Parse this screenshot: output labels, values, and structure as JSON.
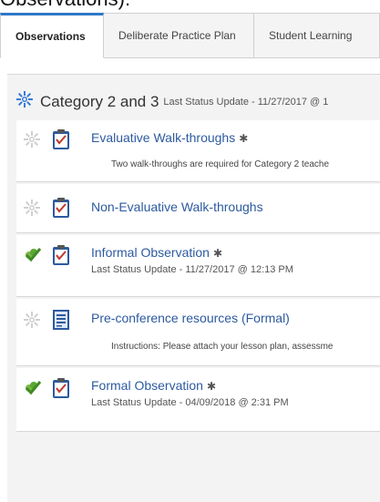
{
  "page_heading_fragment": "Observations):",
  "tabs": [
    {
      "label": "Observations",
      "active": true
    },
    {
      "label": "Deliberate Practice Plan",
      "active": false
    },
    {
      "label": "Student Learning",
      "active": false
    }
  ],
  "category": {
    "title": "Category 2 and 3",
    "status": "Last Status Update - 11/27/2017 @ 1",
    "icon": "gear-icon"
  },
  "items": [
    {
      "title": "Evaluative Walk-throughs",
      "required": "✱",
      "status_icon": "pending-gear-icon",
      "doc_icon": "clipboard-icon",
      "description": "Two walk-throughs are required for Category 2 teache"
    },
    {
      "title": "Non-Evaluative Walk-throughs",
      "status_icon": "pending-gear-icon",
      "doc_icon": "clipboard-icon"
    },
    {
      "title": "Informal Observation",
      "required": "✱",
      "status_icon": "complete-check-icon",
      "doc_icon": "clipboard-icon",
      "sub": "Last Status Update - 11/27/2017 @ 12:13 PM"
    },
    {
      "title": "Pre-conference resources (Formal)",
      "status_icon": "pending-gear-icon",
      "doc_icon": "document-icon",
      "description": "Instructions: Please attach your lesson plan, assessme"
    },
    {
      "title": "Formal Observation",
      "required": "✱",
      "status_icon": "complete-check-icon",
      "doc_icon": "clipboard-icon",
      "sub": "Last Status Update - 04/09/2018 @ 2:31 PM"
    }
  ],
  "colors": {
    "link": "#2c5aa0",
    "tab_active_border": "#2e78c7",
    "check_green": "#5aa832"
  }
}
